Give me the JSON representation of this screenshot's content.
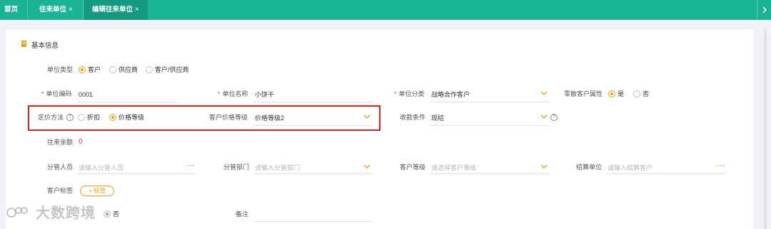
{
  "tabs": [
    {
      "label": "首页",
      "closable": false
    },
    {
      "label": "往来单位",
      "closable": true
    },
    {
      "label": "编辑往来单位",
      "closable": true,
      "active": true
    }
  ],
  "close_glyph": "×",
  "section": {
    "title": "基本信息",
    "icon": "document-icon"
  },
  "unit_type": {
    "label": "单位类型",
    "options": [
      "客户",
      "供应商",
      "客户/供应商"
    ],
    "selected": "客户"
  },
  "row2": {
    "code_label": "单位编码",
    "code_value": "0001",
    "name_label": "单位名称",
    "name_value": "小饼干",
    "category_label": "单位分类",
    "category_value": "战略合作客户",
    "retail_label": "零散客户属性",
    "retail_yes": "是",
    "retail_no": "否",
    "retail_selected": "是"
  },
  "row3": {
    "pricing_label": "定价方法",
    "pricing_options": [
      "折扣",
      "价格等级"
    ],
    "pricing_selected": "价格等级",
    "price_level_label": "客户价格等级",
    "price_level_value": "价格等级2",
    "payment_label": "收款条件",
    "payment_value": "现结"
  },
  "balance": {
    "label": "往来余额",
    "value": "0"
  },
  "row5": {
    "manager_label": "分管人员",
    "manager_placeholder": "请输入分管人员",
    "dept_label": "分管部门",
    "dept_placeholder": "请输入分管部门",
    "level_label": "客户等级",
    "level_placeholder": "请选择客户等级",
    "settle_label": "结算单位",
    "settle_placeholder": "请输入结算客户"
  },
  "tags": {
    "label": "客户标签",
    "button": "+ 标签"
  },
  "row7": {
    "no_label": "否",
    "remark_label": "备注"
  },
  "watermark": "大数跨境",
  "required_mark": "*",
  "help_glyph": "?",
  "more_glyph": "···",
  "colors": {
    "brand": "#1ab394",
    "accent": "#f39c12",
    "required": "#e4393c",
    "highlight_box": "#e02020"
  }
}
